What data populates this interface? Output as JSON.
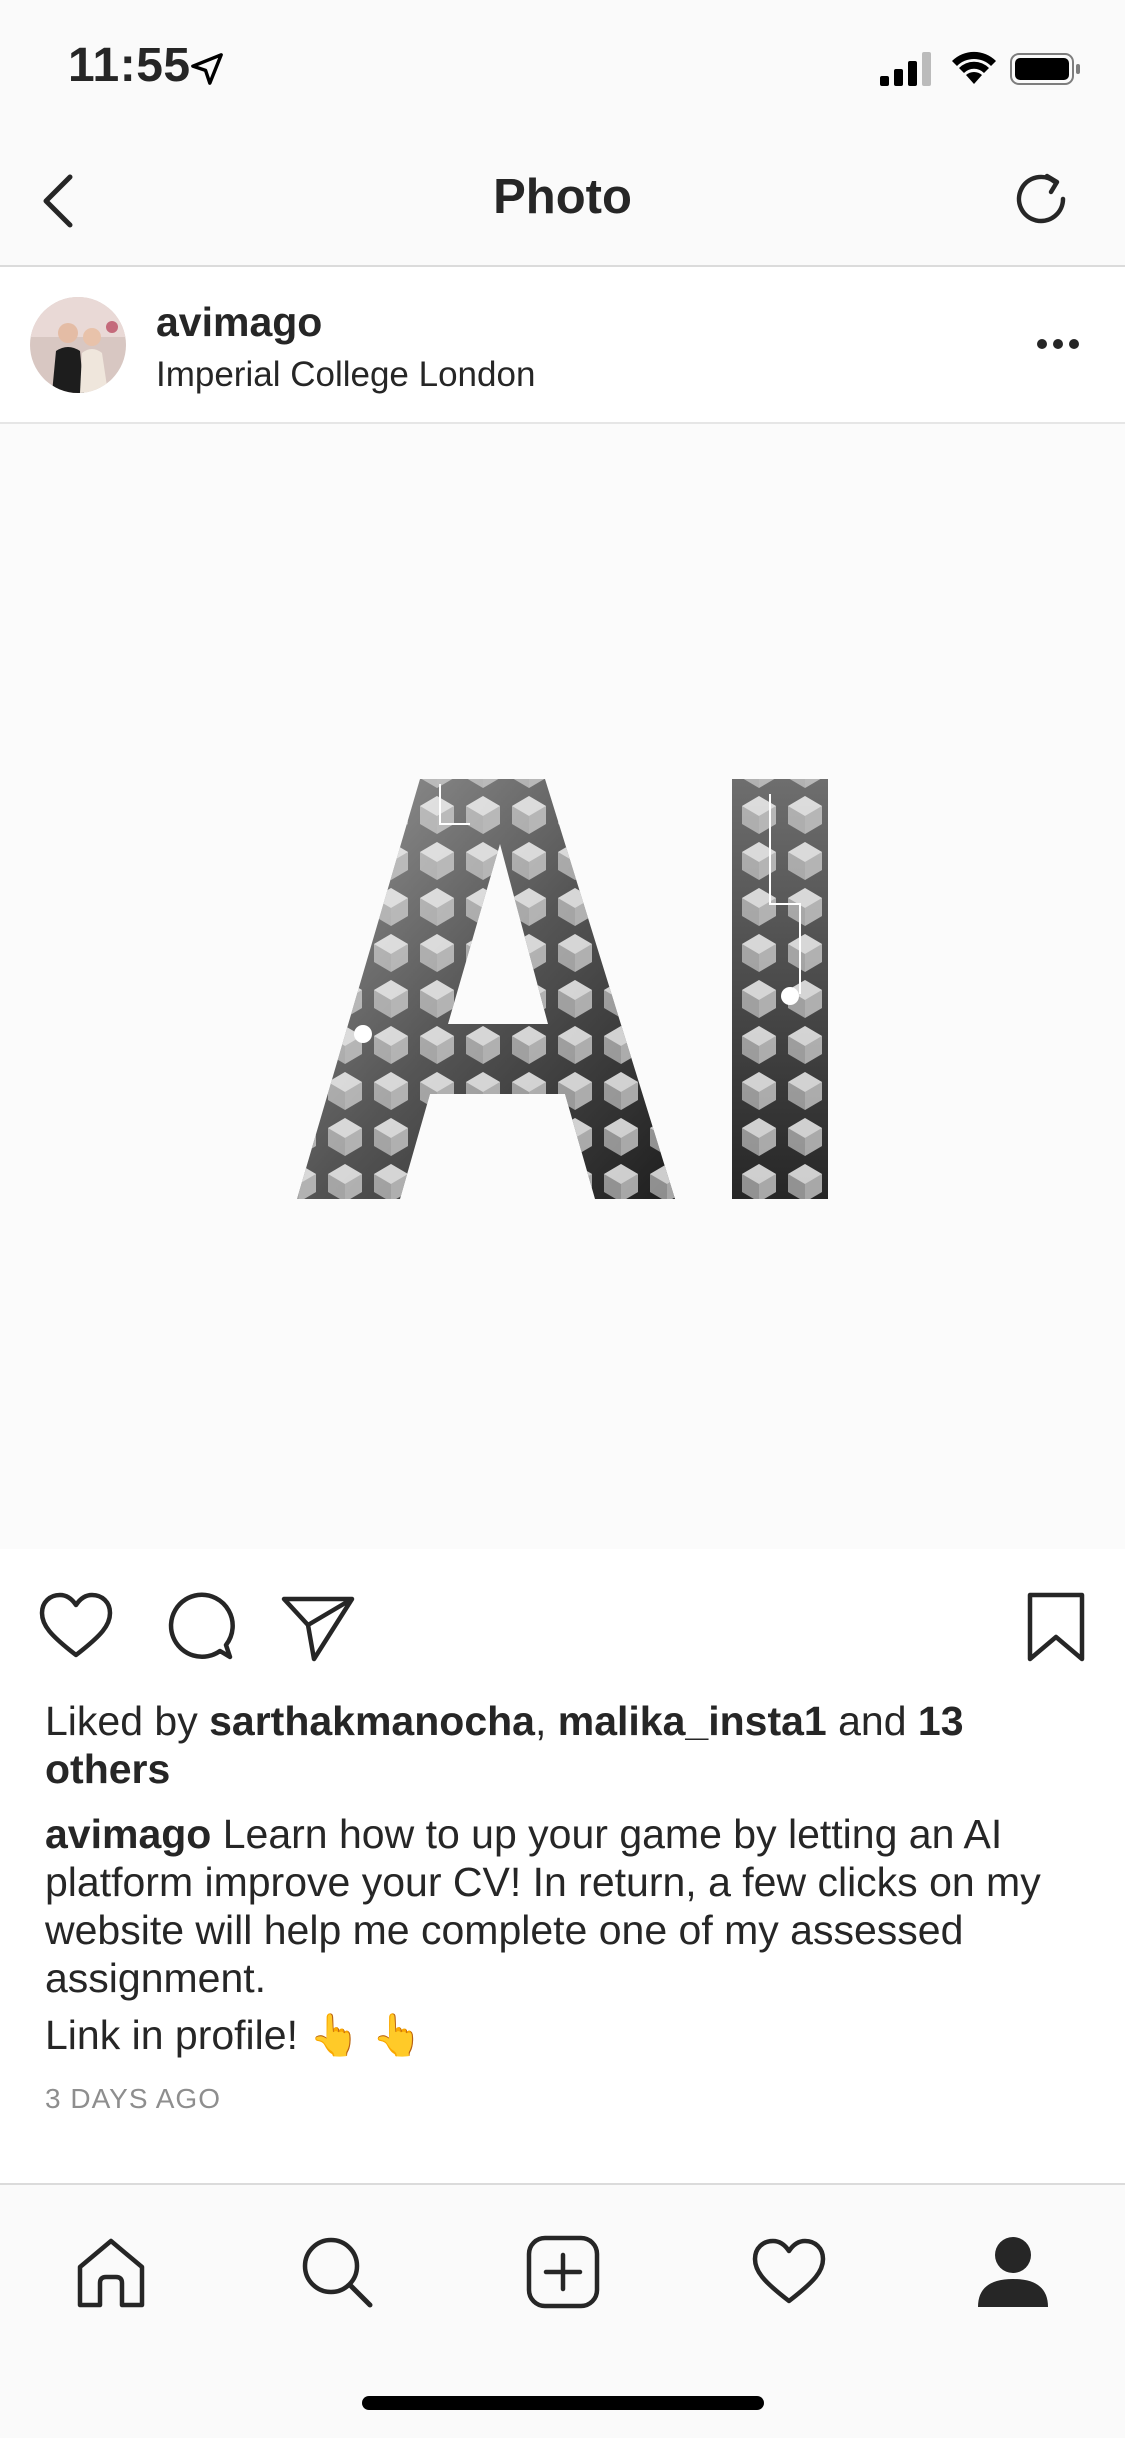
{
  "status_bar": {
    "time": "11:55"
  },
  "header": {
    "title": "Photo"
  },
  "post": {
    "username": "avimago",
    "location": "Imperial College London",
    "image_text": "AI",
    "liked_prefix": "Liked by ",
    "liked_user1": "sarthakmanocha",
    "liked_sep": ", ",
    "liked_user2": "malika_insta1",
    "liked_and": " and ",
    "liked_others": "13 others",
    "caption_user": "avimago",
    "caption_text": " Learn how to up your game by letting an AI platform improve your CV! In return, a few clicks on my website will help me complete one of my assessed assignment.",
    "caption_link_line": "Link in profile! 👆 👆",
    "timestamp": "3 DAYS AGO"
  },
  "colors": {
    "text": "#262626",
    "muted": "#8e8e8e",
    "divider": "#dbdbdb"
  }
}
